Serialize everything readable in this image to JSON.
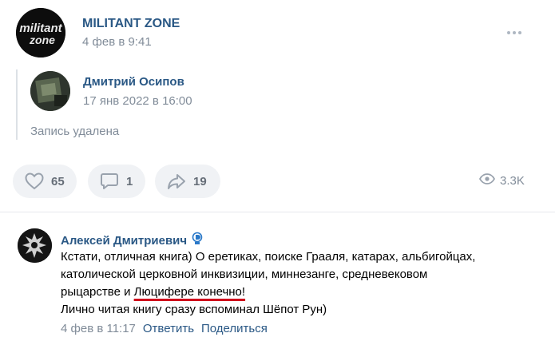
{
  "post": {
    "group_name": "MILITANT ZONE",
    "logo_text_line1": "militant",
    "logo_text_line2": "zone",
    "date": "4 фев в 9:41",
    "repost": {
      "author": "Дмитрий Осипов",
      "date": "17 янв 2022 в 16:00",
      "deleted_text": "Запись удалена"
    },
    "actions": {
      "likes": "65",
      "comments": "1",
      "shares": "19",
      "views": "3.3K"
    }
  },
  "comment": {
    "author": "Алексей Дмитриевич",
    "badge_icon": "dynamo-badge-icon",
    "line1": "Кстати, отличная книга) О еретиках, поиске Грааля, катарах, альбигойцах,",
    "line2": "католической церковной инквизиции, миннезанге, средневековом",
    "line3_before": "рыцарстве и ",
    "line3_underlined": "Люцифере конечно!",
    "line4": "Лично читая книгу сразу вспоминал Шёпот Рун)",
    "date": "4 фев в 11:17",
    "reply_label": "Ответить",
    "share_label": "Поделиться"
  },
  "colors": {
    "link": "#2a5885",
    "muted": "#818c99",
    "pill_bg": "#f0f2f5",
    "underline": "#d0021b"
  }
}
